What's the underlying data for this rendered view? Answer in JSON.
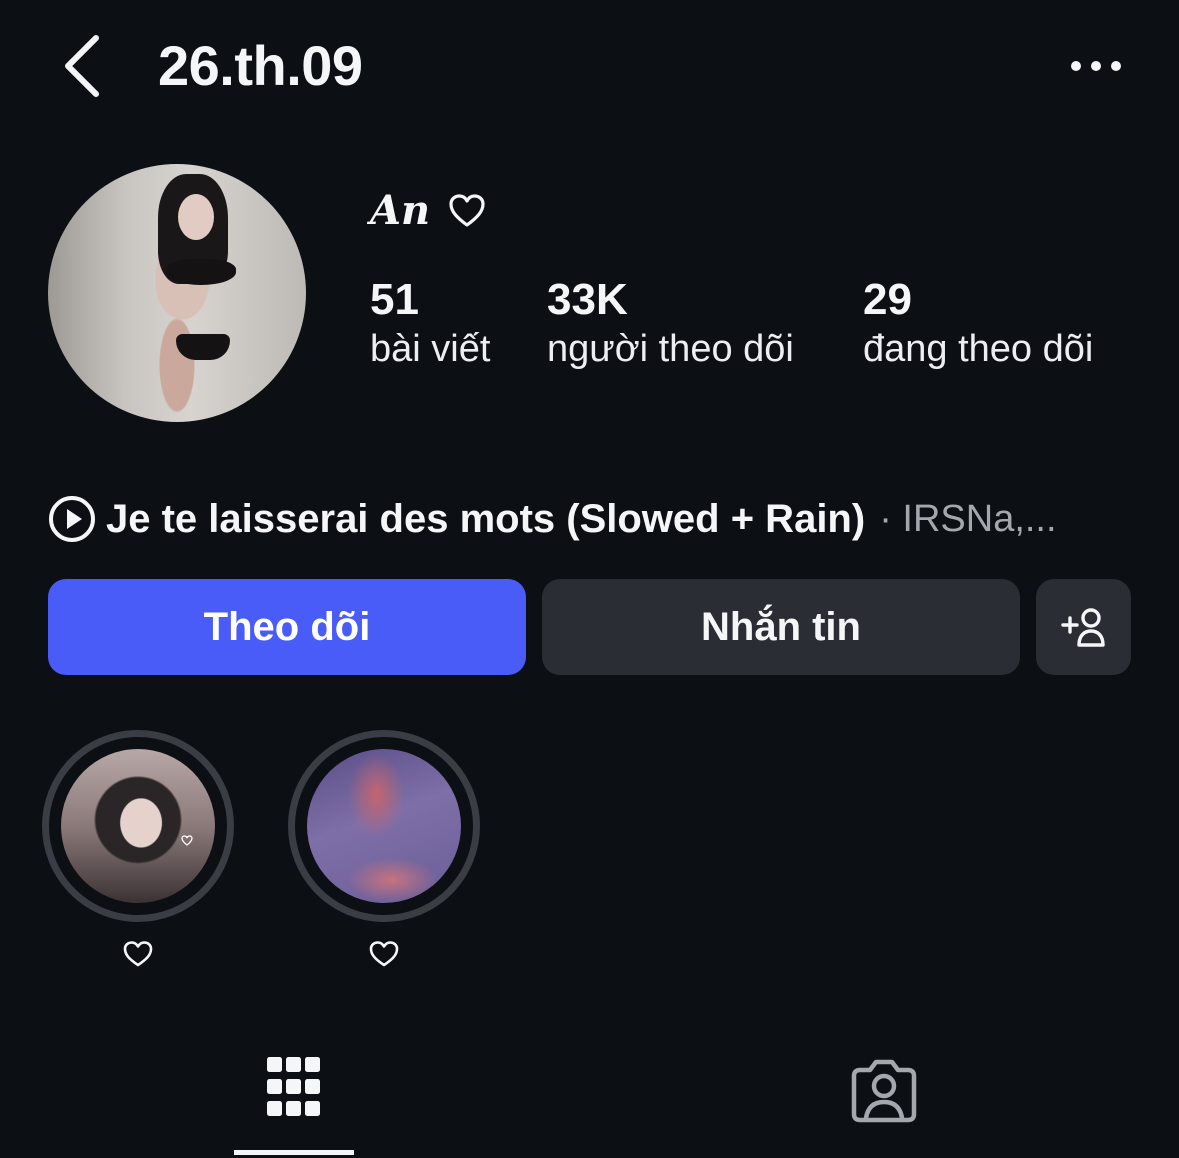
{
  "header": {
    "username": "26.th.09",
    "back_icon": "chevron-left-icon",
    "more_icon": "more-horizontal-icon"
  },
  "profile": {
    "display_name": "An",
    "name_icon": "heart-outline-icon",
    "stats": [
      {
        "value": "51",
        "label": "bài viết"
      },
      {
        "value": "33K",
        "label": "người theo dõi"
      },
      {
        "value": "29",
        "label": "đang theo dõi"
      }
    ]
  },
  "music": {
    "icon": "play-circle-icon",
    "title": "Je te laisserai des mots (Slowed + Rain)",
    "artist": "· IRSNa,..."
  },
  "actions": {
    "follow_label": "Theo dõi",
    "message_label": "Nhắn tin",
    "add_icon": "add-person-icon",
    "follow_color": "#4a5cf7"
  },
  "highlights": [
    {
      "label_icon": "heart-outline-icon"
    },
    {
      "label_icon": "heart-outline-icon"
    }
  ],
  "tabs": [
    {
      "icon": "grid-icon",
      "active": true
    },
    {
      "icon": "tagged-person-icon",
      "active": false
    }
  ]
}
